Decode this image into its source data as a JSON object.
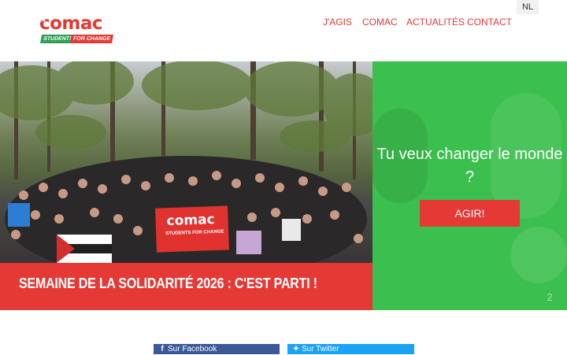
{
  "header": {
    "logo": {
      "word": "comac",
      "tag_left": "STUDENTS",
      "tag_right": "FOR CHANGE"
    },
    "nav": [
      {
        "label": "J'AGIS"
      },
      {
        "label": "COMAC"
      },
      {
        "label": "ACTUALITÉS"
      },
      {
        "label": "CONTACT"
      }
    ],
    "lang": "NL"
  },
  "hero": {
    "banner_word": "comac",
    "banner_tag": "STUDENTS FOR CHANGE",
    "caption": "SEMAINE DE LA SOLIDARITÉ 2026 : C'EST PARTI !"
  },
  "cta": {
    "title": "Tu veux changer le monde ?",
    "button": "AGIR!",
    "slide_number": "2"
  },
  "share": {
    "facebook": "Sur Facebook",
    "twitter": "Sur Twitter",
    "facebook_icon": "f",
    "twitter_icon": "✦"
  },
  "colors": {
    "brand_red": "#e53935",
    "brand_green": "#3bbf4e",
    "facebook": "#3b5998",
    "twitter": "#1da1f2"
  }
}
